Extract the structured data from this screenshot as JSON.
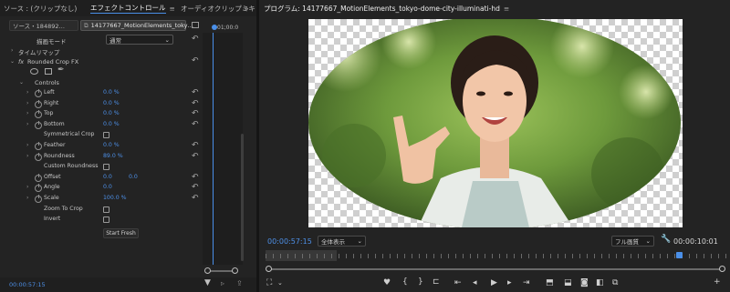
{
  "left_tabs": {
    "source": "ソース : (クリップなし)",
    "effect_controls": "エフェクトコントロール",
    "audio_mixer": "オーディオクリップミキ",
    "overflow": "»",
    "menu": "≡"
  },
  "clip_selector": {
    "source_clip": "ソース・184892…",
    "sequence_clip": "14177667_MotionElements_toky…"
  },
  "timecode_ruler": "01;00:0",
  "effects": {
    "blend_mode_label": "描画モード",
    "blend_mode_value": "通常",
    "time_remap": "タイムリマップ",
    "fx_name": "Rounded Crop FX",
    "fx_prefix": "fx",
    "controls": "Controls",
    "params": [
      {
        "label": "Left",
        "value": "0.0 %",
        "type": "value",
        "twirl": true,
        "stopwatch": true
      },
      {
        "label": "Right",
        "value": "0.0 %",
        "type": "value",
        "twirl": true,
        "stopwatch": true
      },
      {
        "label": "Top",
        "value": "0.0 %",
        "type": "value",
        "twirl": true,
        "stopwatch": true
      },
      {
        "label": "Bottom",
        "value": "0.0 %",
        "type": "value",
        "twirl": true,
        "stopwatch": true
      },
      {
        "label": "Symmetrical Crop",
        "value": "",
        "type": "checkbox",
        "checked": false,
        "twirl": false,
        "stopwatch": false
      },
      {
        "label": "Feather",
        "value": "0.0 %",
        "type": "value",
        "twirl": true,
        "stopwatch": true
      },
      {
        "label": "Roundness",
        "value": "89.0 %",
        "type": "value",
        "twirl": true,
        "stopwatch": true
      },
      {
        "label": "Custom Roundness",
        "value": "",
        "type": "checkbox",
        "checked": false,
        "twirl": false,
        "stopwatch": false
      },
      {
        "label": "Offset",
        "value": "0.0",
        "value2": "0.0",
        "type": "pair",
        "twirl": false,
        "stopwatch": true
      },
      {
        "label": "Angle",
        "value": "0.0",
        "type": "value",
        "twirl": true,
        "stopwatch": true
      },
      {
        "label": "Scale",
        "value": "100.0 %",
        "type": "value",
        "twirl": true,
        "stopwatch": true
      },
      {
        "label": "Zoom To Crop",
        "value": "",
        "type": "checkbox",
        "checked": false,
        "twirl": false,
        "stopwatch": false
      },
      {
        "label": "Invert",
        "value": "",
        "type": "checkbox",
        "checked": false,
        "twirl": false,
        "stopwatch": false
      }
    ],
    "start_fresh": "Start Fresh"
  },
  "left_footer": {
    "timecode": "00:00:57:15"
  },
  "program": {
    "title": "プログラム: 14177667_MotionElements_tokyo-dome-city-illuminati-hd",
    "menu": "≡",
    "timecode": "00:00:57:15",
    "zoom": "全体表示",
    "resolution": "フル画質",
    "duration": "00:00:10:01"
  },
  "colors": {
    "accent": "#4d8fe6",
    "playhead": "#4a8fe8",
    "panel": "#232323",
    "background": "#1d1d1d"
  }
}
